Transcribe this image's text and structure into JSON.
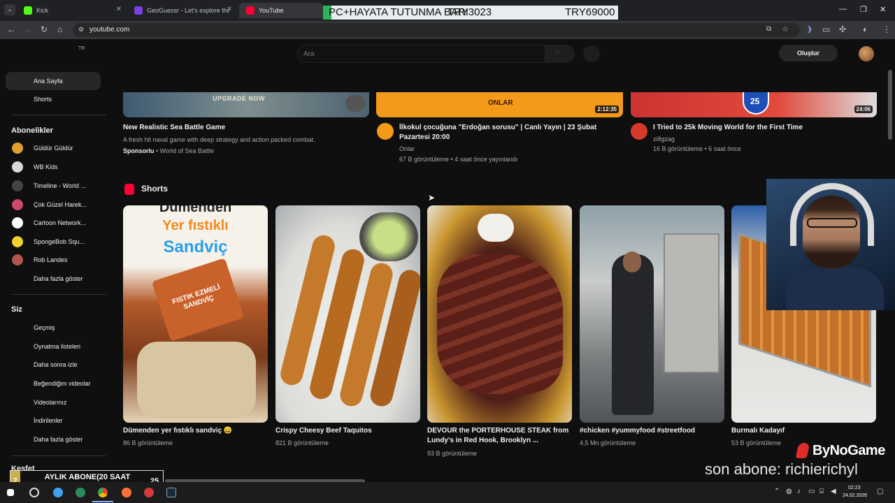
{
  "browser": {
    "tabs": [
      {
        "title": "Kick",
        "color": "#53fc18"
      },
      {
        "title": "GeoGuessr - Let's explore the world!",
        "color": "#7b3fe4"
      },
      {
        "title": "YouTube",
        "color": "#ff0033"
      }
    ],
    "url": "youtube.com"
  },
  "overlay": {
    "banner_text": "PC+HAYATA TUTUNMA BARI",
    "banner_mid": "TRY3023",
    "banner_right": "TRY69000",
    "brand": "ByNoGame",
    "last_sub": "son abone: richierichyl",
    "sub_goal_label": "AYLIK ABONE(20 SAAT YAYIN)",
    "sub_goal_current": "2",
    "sub_goal_target": "25"
  },
  "youtube": {
    "country": "TR",
    "search_placeholder": "Ara",
    "create_label": "Oluştur",
    "sidebar": {
      "home": "Ana Sayfa",
      "shorts": "Shorts",
      "subs_header": "Abonelikler",
      "subscriptions": [
        {
          "name": "Güldür Güldür",
          "color": "#e0a030"
        },
        {
          "name": "WB Kids",
          "color": "#d9d9d9"
        },
        {
          "name": "Timeline - World ...",
          "color": "#444444"
        },
        {
          "name": "Çok Güzel Harek...",
          "color": "#c94a6a"
        },
        {
          "name": "Cartoon Network...",
          "color": "#ffffff"
        },
        {
          "name": "SpongeBob Squ...",
          "color": "#f2d22e"
        },
        {
          "name": "Rob Landes",
          "color": "#b3564e"
        }
      ],
      "show_more_subs": "Daha fazla göster",
      "you_header": "Siz",
      "you_items": [
        "Geçmiş",
        "Oynatma listeleri",
        "Daha sonra izle",
        "Beğendiğim videolar",
        "Videolarınız",
        "İndirilenler"
      ],
      "show_more_you": "Daha fazla göster",
      "explore_header": "Keşfet"
    },
    "videos": [
      {
        "title": "New Realistic Sea Battle Game",
        "desc": "A fresh hit naval game with deep strategy and action packed combat.",
        "sponsored": "Sponsorlu",
        "channel": "World of Sea Battle",
        "thumb_button": "UPGRADE NOW"
      },
      {
        "title": "İlkokul çocuğuna \"Erdoğan sorusu\" | Canlı Yayın | 23 Şubat Pazartesi 20:00",
        "channel": "Onlar",
        "meta": "67 B görüntüleme • 4 saat önce yayınlandı",
        "duration": "2:12:35",
        "thumb_logo": "ONLAR"
      },
      {
        "title": "I Tried to 25k Moving World for the First Time",
        "channel": "zi8gzag",
        "meta": "16 B görüntüleme • 6 saat önce",
        "duration": "24:06",
        "thumb_sign": "25"
      }
    ],
    "shorts_header": "Shorts",
    "shorts": [
      {
        "title": "Dümenden yer fıstıklı sandviç 😄",
        "views": "86 B görüntüleme",
        "overlay_top": "Dümenden",
        "overlay_mid": "Yer fıstıklı",
        "overlay_bottom": "Sandviç",
        "pack_text": "FISTIK EZMELİ SANDVİÇ"
      },
      {
        "title": "Crispy Cheesy Beef Taquitos",
        "views": "821 B görüntüleme"
      },
      {
        "title": "DEVOUR the PORTERHOUSE STEAK from Lundy's in Red Hook, Brooklyn ...",
        "views": "93 B görüntüleme"
      },
      {
        "title": "#chicken #yummyfood #streetfood",
        "views": "4,5 Mn görüntüleme"
      },
      {
        "title": "Burmalı Kadayıf",
        "views": "53 B görüntüleme"
      }
    ]
  },
  "taskbar": {
    "time": "02:23",
    "date": "24.02.2026"
  }
}
